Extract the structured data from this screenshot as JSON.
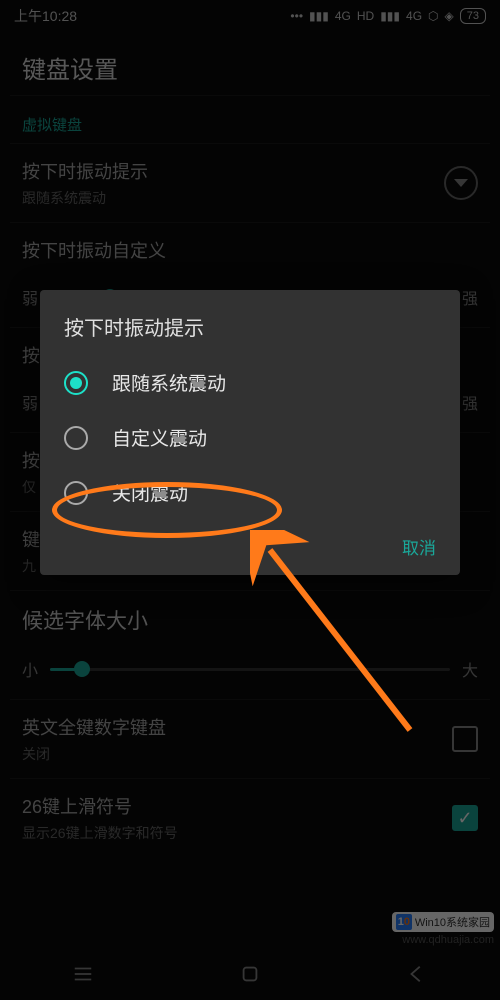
{
  "status": {
    "time": "上午10:28",
    "net1": "4G",
    "hd": "HD",
    "net2": "4G",
    "battery": "73"
  },
  "page": {
    "title": "键盘设置",
    "section_virtual": "虚拟键盘"
  },
  "rows": {
    "vibrate": {
      "title": "按下时振动提示",
      "sub": "跟随系统震动"
    },
    "vibrate_custom": {
      "title": "按下时振动自定义"
    },
    "slider1": {
      "left": "弱",
      "right": "强"
    },
    "partial1": {
      "title": "按"
    },
    "partial2": {
      "left": "弱",
      "right": "强"
    },
    "partial3": {
      "title": "按",
      "sub": "仅"
    },
    "partial4": {
      "title": "键",
      "sub": "九"
    },
    "font_size": {
      "title": "候选字体大小",
      "left": "小",
      "right": "大",
      "pos": 8
    },
    "english_num": {
      "title": "英文全键数字键盘",
      "sub": "关闭",
      "checked": false
    },
    "key26": {
      "title": "26键上滑符号",
      "sub": "显示26键上滑数字和符号",
      "checked": true
    }
  },
  "dialog": {
    "title": "按下时振动提示",
    "options": [
      "跟随系统震动",
      "自定义震动",
      "关闭震动"
    ],
    "selected": 0,
    "cancel": "取消"
  },
  "watermark": {
    "brand": "Win10系统家园",
    "url": "www.qdhuajia.com"
  }
}
